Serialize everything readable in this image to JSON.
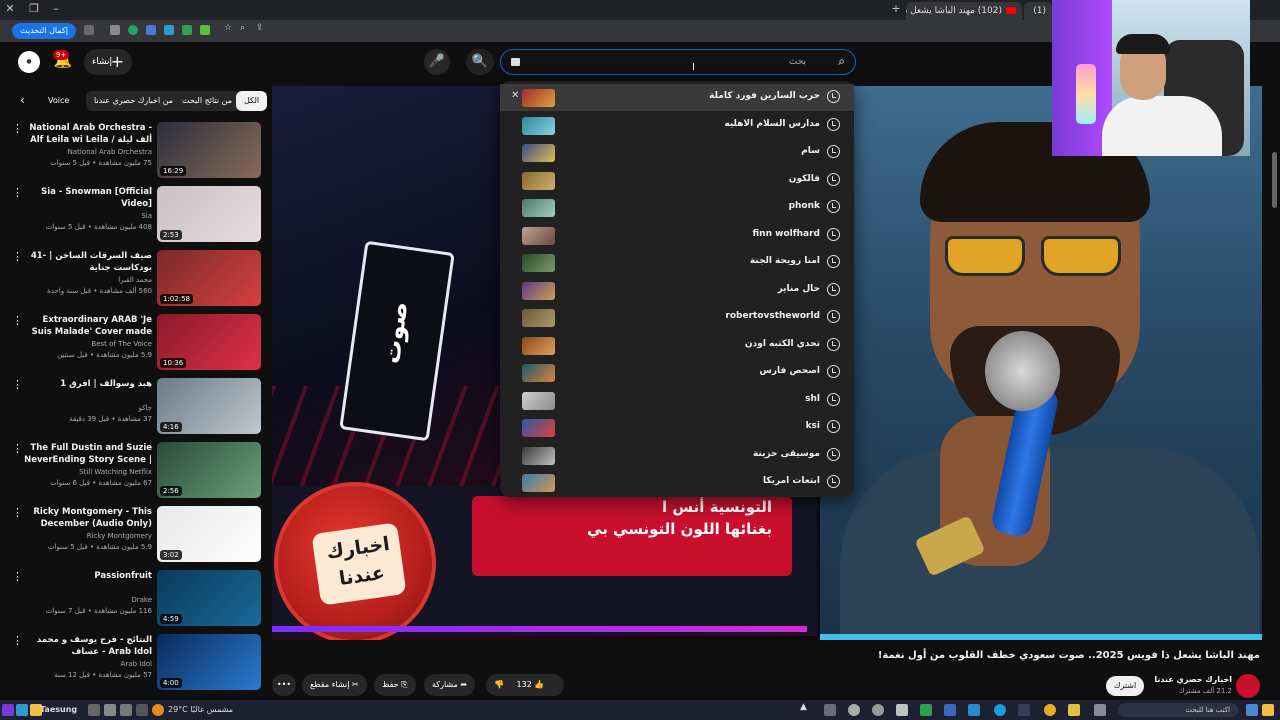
{
  "browser": {
    "tabs": [
      {
        "label": "(102) مهند الباشا يشعل ذا فويس",
        "active": true
      },
      {
        "label": "(1)"
      }
    ],
    "update_button": "إكمال التحديث"
  },
  "header": {
    "notification_count": "9+",
    "create_label": "إنشاء",
    "search_placeholder": "بحث"
  },
  "chips": [
    "الكل",
    "من نتائج البحث",
    "من اخبارك حصري عندنا",
    "Voice"
  ],
  "recommendations": [
    {
      "title": "National Arab Orchestra - Alf Leila wi Leila / ألف ليلة وليلة - Mai...",
      "channel": "National Arab Orchestra",
      "meta": "75 مليون مشاهدة • قبل 5 سنوات",
      "duration": "16:29",
      "color1": "#2a2f3a",
      "color2": "#8a6a5a"
    },
    {
      "title": "Sia - Snowman [Official Video]",
      "channel": "Sia",
      "meta": "408 مليون مشاهدة • قبل 5 سنوات",
      "duration": "2:53",
      "color1": "#c9c0c4",
      "color2": "#e8dce0"
    },
    {
      "title": "41- صيف السرقات الساخن | بودكاست جناية",
      "channel": "محمد القبرا",
      "meta": "560 ألف مشاهدة • قبل سنة واحدة",
      "duration": "1:02:58",
      "color1": "#7a2a2a",
      "color2": "#d64040"
    },
    {
      "title": "Extraordinary ARAB 'Je Suis Malade' Cover made the ...",
      "channel": "Best of The Voice",
      "meta": "5.9 مليون مشاهدة • قبل سنتين",
      "duration": "10:36",
      "color1": "#8a1a2a",
      "color2": "#e0304a"
    },
    {
      "title": "هبد وسوالف | افرق 1",
      "channel": "جاكو",
      "meta": "37 مشاهدة • قبل 39 دقيقة",
      "duration": "4:16",
      "color1": "#6a7a8a",
      "color2": "#c0c8cc"
    },
    {
      "title": "The Full Dustin and Suzie NeverEnding Story Scene | ...",
      "channel": "Still Watching Netflix",
      "meta": "67 مليون مشاهدة • قبل 6 سنوات",
      "duration": "2:56",
      "color1": "#2a4a3a",
      "color2": "#6aa07a"
    },
    {
      "title": "Ricky Montgomery - This December (Audio Only)",
      "channel": "Ricky Montgomery",
      "meta": "5.9 مليون مشاهدة • قبل 5 سنوات",
      "duration": "3:02",
      "color1": "#e8e8e8",
      "color2": "#ffffff"
    },
    {
      "title": "Passionfruit",
      "channel": "Drake",
      "meta": "116 مليون مشاهدة • قبل 7 سنوات",
      "duration": "4:59",
      "color1": "#0a3a5a",
      "color2": "#1a6a9a"
    },
    {
      "title": "النتائج - فرح يوسف و محمد عساف - Arab Idol",
      "channel": "Arab Idol",
      "meta": "57 مليون مشاهدة • قبل 12 سنة",
      "duration": "4:00",
      "color1": "#0a2a5a",
      "color2": "#2a7ad0"
    }
  ],
  "suggestions": [
    {
      "text": "حرب السارين فورد كاملة",
      "color1": "#a02a2a",
      "color2": "#e0a040"
    },
    {
      "text": "مدارس السلام الاهليه",
      "color1": "#2a8a9a",
      "color2": "#8ad0e0"
    },
    {
      "text": "سام",
      "color1": "#3a4a8a",
      "color2": "#e0c050"
    },
    {
      "text": "فالكون",
      "color1": "#8a6a2a",
      "color2": "#d0b070"
    },
    {
      "text": "phonk",
      "color1": "#4a7a6a",
      "color2": "#a0d0c0"
    },
    {
      "text": "finn wolfhard",
      "color1": "#c0a090",
      "color2": "#6a4a40"
    },
    {
      "text": "امنا رويحة الجنة",
      "color1": "#2a4a2a",
      "color2": "#7a9a6a"
    },
    {
      "text": "حال مناير",
      "color1": "#5a3a8a",
      "color2": "#d0a050"
    },
    {
      "text": "robertovstheworld",
      "color1": "#6a5a3a",
      "color2": "#b09a6a"
    },
    {
      "text": "تحدي الكتبه اودن",
      "color1": "#8a4a1a",
      "color2": "#e0a060"
    },
    {
      "text": "اصحص فارس",
      "color1": "#1a5a6a",
      "color2": "#e08040"
    },
    {
      "text": "shl",
      "color1": "#d0d0d0",
      "color2": "#8a8a8a"
    },
    {
      "text": "ksi",
      "color1": "#2a5aa0",
      "color2": "#e04040"
    },
    {
      "text": "موسيقى حزينة",
      "color1": "#3a3a3a",
      "color2": "#c0c0c0"
    },
    {
      "text": "ابتعات امريكا",
      "color1": "#3a7ab0",
      "color2": "#d09a50"
    }
  ],
  "video": {
    "title": "مهند الباشا يشعل ذا فويس 2025.. صوت سعودي خطف القلوب من أول نغمة!",
    "stage_sign": "صوت",
    "lower_text_line1": "التونسية  أنس ا",
    "lower_text_line2": "بغنائها اللون التونسي بي",
    "badge_line1": "اخبارك",
    "badge_line2": "عندنا",
    "channel": "اخبارك حصري عندنا",
    "subscribers": "21.2 ألف مشترك",
    "subscribe_label": "اشترك",
    "likes": "132",
    "share_label": "مشاركة",
    "save_label": "حفظ",
    "clip_label": "إنشاء مقطع"
  },
  "taskbar": {
    "user_label": "Taesung",
    "weather": "29°C  مشمس غالبًا",
    "search_placeholder": "اكتب هنا للبحث"
  }
}
